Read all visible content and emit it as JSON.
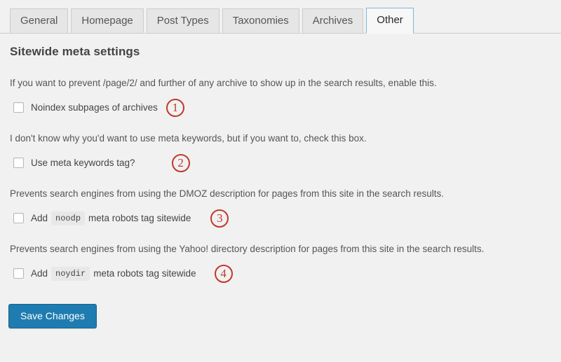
{
  "tabs": [
    {
      "label": "General",
      "active": false
    },
    {
      "label": "Homepage",
      "active": false
    },
    {
      "label": "Post Types",
      "active": false
    },
    {
      "label": "Taxonomies",
      "active": false
    },
    {
      "label": "Archives",
      "active": false
    },
    {
      "label": "Other",
      "active": true
    }
  ],
  "page": {
    "title": "Sitewide meta settings"
  },
  "sections": [
    {
      "description": "If you want to prevent /page/2/ and further of any archive to show up in the search results, enable this.",
      "label_before": "Noindex subpages of archives",
      "code": "",
      "label_after": "",
      "checked": false,
      "marker": "①",
      "marker_number": "1"
    },
    {
      "description": "I don't know why you'd want to use meta keywords, but if you want to, check this box.",
      "label_before": "Use meta keywords tag?",
      "code": "",
      "label_after": "",
      "checked": false,
      "marker": "②",
      "marker_number": "2"
    },
    {
      "description": "Prevents search engines from using the DMOZ description for pages from this site in the search results.",
      "label_before": "Add",
      "code": "noodp",
      "label_after": "meta robots tag sitewide",
      "checked": false,
      "marker": "③",
      "marker_number": "3"
    },
    {
      "description": "Prevents search engines from using the Yahoo! directory description for pages from this site in the search results.",
      "label_before": "Add",
      "code": "noydir",
      "label_after": "meta robots tag sitewide",
      "checked": false,
      "marker": "④",
      "marker_number": "4"
    }
  ],
  "footer": {
    "save_label": "Save Changes"
  },
  "colors": {
    "background": "#f1f1f1",
    "accent_blue": "#1e7cb0",
    "active_tab_border": "#79b7d8",
    "marker_red": "#c0392b",
    "text": "#444444"
  }
}
